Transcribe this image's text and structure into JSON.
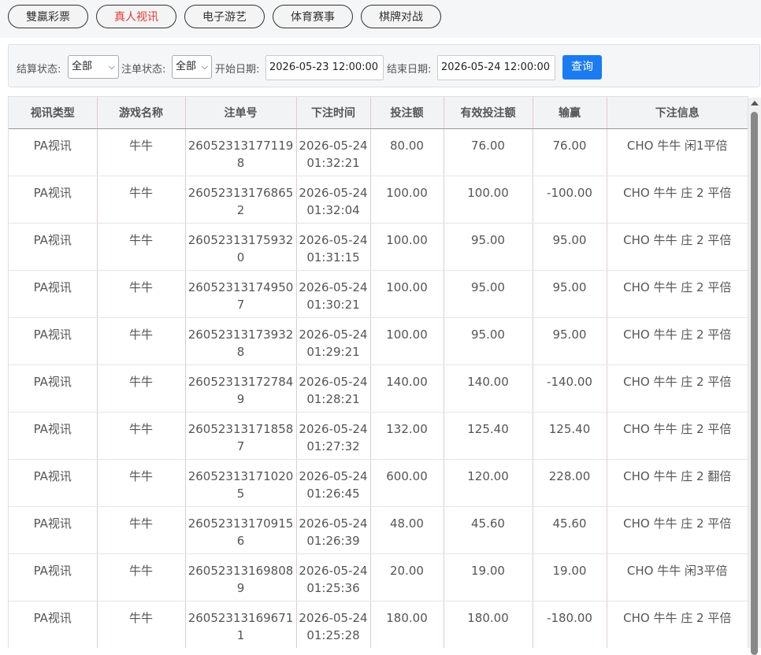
{
  "tabs": [
    {
      "label": "雙贏彩票"
    },
    {
      "label": "真人视讯"
    },
    {
      "label": "电子游艺"
    },
    {
      "label": "体育赛事"
    },
    {
      "label": "棋牌对战"
    }
  ],
  "active_tab_index": 1,
  "accent_color": "#e53935",
  "query_button_color": "#1a7cf0",
  "filter": {
    "settle_label": "结算状态:",
    "settle_value": "全部",
    "order_label": "注单状态:",
    "order_value": "全部",
    "start_label": "开始日期:",
    "start_value": "2026-05-23 12:00:00",
    "end_label": "结束日期:",
    "end_value": "2026-05-24 12:00:00",
    "query_label": "查询"
  },
  "table": {
    "headers": [
      "视讯类型",
      "游戏名称",
      "注单号",
      "下注时间",
      "投注额",
      "有效投注额",
      "输赢",
      "下注信息"
    ],
    "rows": [
      [
        "PA视讯",
        "牛牛",
        "260523131771198",
        "2026-05-24 01:32:21",
        "80.00",
        "76.00",
        "76.00",
        "CHO 牛牛 闲1平倍"
      ],
      [
        "PA视讯",
        "牛牛",
        "260523131768652",
        "2026-05-24 01:32:04",
        "100.00",
        "100.00",
        "-100.00",
        "CHO 牛牛 庄 2 平倍"
      ],
      [
        "PA视讯",
        "牛牛",
        "260523131759320",
        "2026-05-24 01:31:15",
        "100.00",
        "95.00",
        "95.00",
        "CHO 牛牛 庄 2 平倍"
      ],
      [
        "PA视讯",
        "牛牛",
        "260523131749507",
        "2026-05-24 01:30:21",
        "100.00",
        "95.00",
        "95.00",
        "CHO 牛牛 庄 2 平倍"
      ],
      [
        "PA视讯",
        "牛牛",
        "260523131739328",
        "2026-05-24 01:29:21",
        "100.00",
        "95.00",
        "95.00",
        "CHO 牛牛 庄 2 平倍"
      ],
      [
        "PA视讯",
        "牛牛",
        "260523131727849",
        "2026-05-24 01:28:21",
        "140.00",
        "140.00",
        "-140.00",
        "CHO 牛牛 庄 2 平倍"
      ],
      [
        "PA视讯",
        "牛牛",
        "260523131718587",
        "2026-05-24 01:27:32",
        "132.00",
        "125.40",
        "125.40",
        "CHO 牛牛 庄 2 平倍"
      ],
      [
        "PA视讯",
        "牛牛",
        "260523131710205",
        "2026-05-24 01:26:45",
        "600.00",
        "120.00",
        "228.00",
        "CHO 牛牛 庄 2 翻倍"
      ],
      [
        "PA视讯",
        "牛牛",
        "260523131709156",
        "2026-05-24 01:26:39",
        "48.00",
        "45.60",
        "45.60",
        "CHO 牛牛 庄 2 平倍"
      ],
      [
        "PA视讯",
        "牛牛",
        "260523131698089",
        "2026-05-24 01:25:36",
        "20.00",
        "19.00",
        "19.00",
        "CHO 牛牛 闲3平倍"
      ],
      [
        "PA视讯",
        "牛牛",
        "260523131696711",
        "2026-05-24 01:25:28",
        "180.00",
        "180.00",
        "-180.00",
        "CHO 牛牛 庄 2 平倍"
      ]
    ]
  }
}
